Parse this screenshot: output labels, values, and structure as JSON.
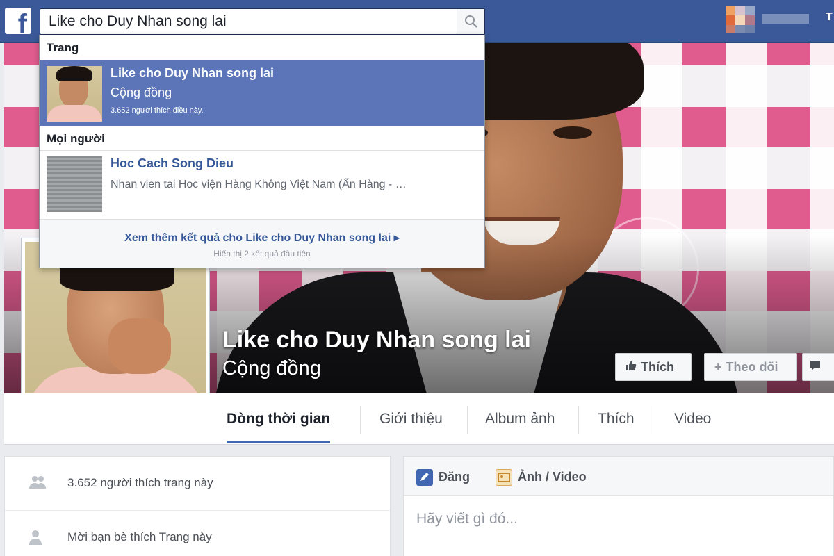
{
  "topbar": {
    "logo": "f",
    "search_value": "Like cho Duy Nhan song lai",
    "search_icon": "search-icon",
    "right_text": "T"
  },
  "dropdown": {
    "section_pages": "Trang",
    "page_result": {
      "title": "Like cho Duy Nhan song lai",
      "category": "Cộng đồng",
      "likes": "3.652 người thích điều này."
    },
    "section_people": "Mọi người",
    "person_result": {
      "name": "Hoc Cach Song Dieu",
      "detail": "Nhan vien tai Hoc viện Hàng Không Việt Nam (Ấn Hàng - …"
    },
    "see_more": "Xem thêm kết quả cho Like cho Duy Nhan song lai ▸",
    "see_more_note": "Hiển thị 2 kết quả đầu tiên"
  },
  "cover": {
    "page_name": "Like cho Duy Nhan song lai",
    "page_category": "Cộng đồng",
    "like_button": "Thích",
    "follow_button": "Theo dõi",
    "message_button": ""
  },
  "tabs": [
    {
      "label": "Dòng thời gian",
      "active": true
    },
    {
      "label": "Giới thiệu"
    },
    {
      "label": "Album ảnh"
    },
    {
      "label": "Thích"
    },
    {
      "label": "Video"
    }
  ],
  "left_card": {
    "likes_text": "3.652 người thích trang này",
    "invite_text": "Mời bạn bè thích Trang này"
  },
  "composer": {
    "post_tab": "Đăng",
    "photo_tab": "Ảnh / Video",
    "placeholder": "Hãy viết gì đó..."
  },
  "colors": {
    "brand": "#3b5998",
    "selected_result": "#5b75b8",
    "link": "#365899"
  }
}
